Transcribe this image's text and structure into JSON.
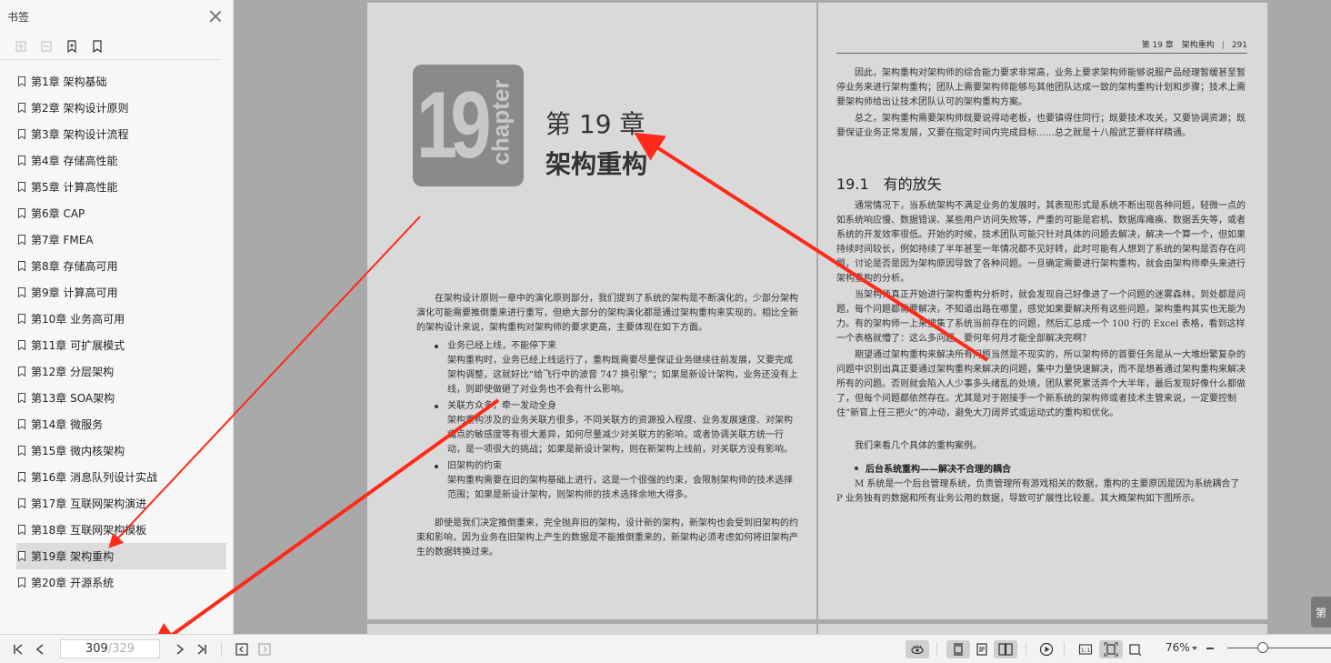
{
  "sidebar": {
    "title": "书签",
    "tools": [
      "expand-all-icon",
      "collapse-all-icon",
      "add-bookmark-icon",
      "bookmark-icon"
    ],
    "items": [
      {
        "label": "第1章 架构基础",
        "active": false
      },
      {
        "label": "第2章 架构设计原则",
        "active": false
      },
      {
        "label": "第3章 架构设计流程",
        "active": false
      },
      {
        "label": "第4章 存储高性能",
        "active": false
      },
      {
        "label": "第5章 计算高性能",
        "active": false
      },
      {
        "label": "第6章 CAP",
        "active": false
      },
      {
        "label": "第7章 FMEA",
        "active": false
      },
      {
        "label": "第8章 存储高可用",
        "active": false
      },
      {
        "label": "第9章 计算高可用",
        "active": false
      },
      {
        "label": "第10章 业务高可用",
        "active": false
      },
      {
        "label": "第11章 可扩展模式",
        "active": false
      },
      {
        "label": "第12章 分层架构",
        "active": false
      },
      {
        "label": "第13章 SOA架构",
        "active": false
      },
      {
        "label": "第14章 微服务",
        "active": false
      },
      {
        "label": "第15章 微内核架构",
        "active": false
      },
      {
        "label": "第16章 消息队列设计实战",
        "active": false
      },
      {
        "label": "第17章 互联网架构演进",
        "active": false
      },
      {
        "label": "第18章 互联网架构模板",
        "active": false
      },
      {
        "label": "第19章 架构重构",
        "active": true
      },
      {
        "label": "第20章 开源系统",
        "active": false
      }
    ]
  },
  "left_page": {
    "badge_number": "19",
    "badge_word": "chapter",
    "chapter_title": "第 19 章",
    "chapter_subtitle": "架构重构",
    "intro": "在架构设计原则一章中的演化原则部分，我们提到了系统的架构是不断演化的，少部分架构演化可能需要推倒重来进行重写，但绝大部分的架构演化都是通过架构重构来实现的。相比全新的架构设计来说，架构重构对架构师的要求更高，主要体现在如下方面。",
    "bullets": [
      {
        "title": "业务已经上线，不能停下来",
        "body": "架构重构时，业务已经上线运行了，重构既需要尽量保证业务继续往前发展，又要完成架构调整，这就好比“给飞行中的波音 747 换引擎”；如果是新设计架构，业务还没有上线，则即使做砸了对业务也不会有什么影响。"
      },
      {
        "title": "关联方众多，牵一发动全身",
        "body": "架构重构涉及的业务关联方很多，不同关联方的资源投入程度、业务发展速度、对架构痛点的敏感度等有很大差异，如何尽量减少对关联方的影响，或者协调关联方统一行动，是一项很大的挑战；如果是新设计架构，则在新架构上线前，对关联方没有影响。"
      },
      {
        "title": "旧架构的约束",
        "body": "架构重构需要在旧的架构基础上进行，这是一个很强的约束，会限制架构师的技术选择范围；如果是新设计架构，则架构师的技术选择余地大得多。"
      }
    ],
    "outro": "即使是我们决定推倒重来，完全抛弃旧的架构，设计新的架构，新架构也会受到旧架构的约束和影响，因为业务在旧架构上产生的数据是不能推倒重来的，新架构必须考虑如何将旧架构产生的数据转换过来。"
  },
  "right_page": {
    "running_head_chapter": "第 19 章　架构重构",
    "running_head_sep": "|",
    "page_number": "291",
    "p1": "因此，架构重构对架构师的综合能力要求非常高，业务上要求架构师能够说服产品经理暂缓甚至暂停业务来进行架构重构；团队上需要架构师能够与其他团队达成一致的架构重构计划和步骤；技术上需要架构师给出让技术团队认可的架构重构方案。",
    "p2": "总之，架构重构需要架构师既要说得动老板，也要镇得住同行；既要技术攻关，又要协调资源；既要保证业务正常发展，又要在指定时间内完成目标……总之就是十八般武艺要样样精通。",
    "section_heading": "19.1　有的放矢",
    "p3": "通常情况下，当系统架构不满足业务的发展时，其表现形式是系统不断出现各种问题，轻微一点的如系统响应慢、数据错误、某些用户访问失败等，严重的可能是宕机、数据库瘫痪、数据丢失等，或者系统的开发效率很低。开始的时候，技术团队可能只针对具体的问题去解决，解决一个算一个，但如果持续时间较长，例如持续了半年甚至一年情况都不见好转，此时可能有人想到了系统的架构是否存在问题，讨论是否是因为架构原因导致了各种问题。一旦确定需要进行架构重构，就会由架构师牵头来进行架构重构的分析。",
    "p4": "当架构师真正开始进行架构重构分析时，就会发现自己好像进了一个问题的迷雾森林，到处都是问题，每个问题都需要解决，不知道出路在哪里，感觉如果要解决所有这些问题，架构重构其实也无能为力。有的架构师一上来搜集了系统当前存在的问题，然后汇总成一个 100 行的 Excel 表格，看到这样一个表格就懵了：这么多问题，要何年何月才能全部解决完啊？",
    "p5": "期望通过架构重构来解决所有问题当然是不现实的，所以架构师的首要任务是从一大堆纷繁复杂的问题中识别出真正要通过架构重构来解决的问题，集中力量快速解决，而不是想着通过架构重构来解决所有的问题。否则就会陷入人少事多头绪乱的处境，团队累死累活弄个大半年，最后发现好像什么都做了，但每个问题都依然存在。尤其是对于刚接手一个新系统的架构师或者技术主管来说，一定要控制住“新官上任三把火”的冲动，避免大刀阔斧式或运动式的重构和优化。",
    "p6": "我们来看几个具体的重构案例。",
    "bullet": "后台系统重构——解决不合理的耦合",
    "p7": "M 系统是一个后台管理系统，负责管理所有游戏相关的数据，重构的主要原因是因为系统耦合了 P 业务独有的数据和所有业务公用的数据，导致可扩展性比较差。其大概架构如下图所示。",
    "corner_char": "第"
  },
  "toolbar": {
    "current_page": "309",
    "separator": "/",
    "total_pages": "329",
    "zoom": "76%",
    "zoom_level_percent": 76
  },
  "annotation_color": "#ff2a1a"
}
